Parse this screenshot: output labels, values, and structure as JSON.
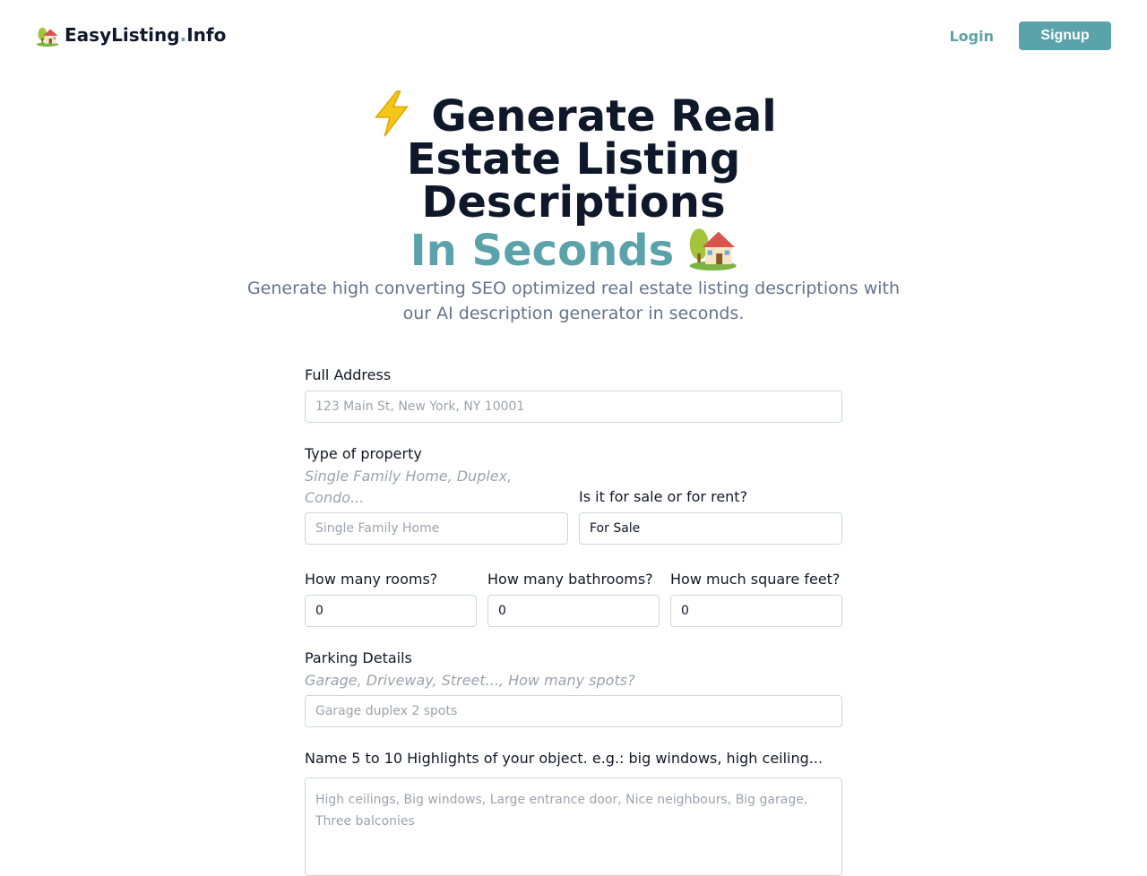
{
  "header": {
    "logo_text_main": "EasyListing",
    "logo_text_dot": ".",
    "logo_text_end": "Info",
    "login_label": "Login",
    "signup_label": "Signup"
  },
  "hero": {
    "title_line1": "Generate Real",
    "title_line2": "Estate Listing",
    "title_line3": "Descriptions",
    "title_accent": "In Seconds",
    "subtitle_line1": "Generate high converting SEO optimized real estate listing descriptions with",
    "subtitle_line2": "our AI description generator in seconds."
  },
  "form": {
    "address": {
      "label": "Full Address",
      "placeholder": "123 Main St, New York, NY 10001"
    },
    "property_type": {
      "label": "Type of property",
      "hint_line1": "Single Family Home, Duplex,",
      "hint_line2": "Condo...",
      "placeholder": "Single Family Home"
    },
    "sale_rent": {
      "label": "Is it for sale or for rent?",
      "value": "For Sale"
    },
    "rooms": {
      "label": "How many rooms?",
      "value": "0"
    },
    "bathrooms": {
      "label": "How many bathrooms?",
      "value": "0"
    },
    "sqft": {
      "label": "How much square feet?",
      "value": "0"
    },
    "parking": {
      "label": "Parking Details",
      "hint": "Garage, Driveway, Street..., How many spots?",
      "placeholder": "Garage duplex 2 spots"
    },
    "highlights": {
      "label": "Name 5 to 10 Highlights of your object. e.g.: big windows, high ceiling...",
      "placeholder_line1": "High ceilings, Big windows, Large entrance door, Nice neighbours, Big garage,",
      "placeholder_line2": "Three balconies"
    }
  },
  "colors": {
    "accent": "#5ba3aa",
    "heading": "#0f172a",
    "muted": "#64748b"
  },
  "icons": {
    "logo": "house-with-garden-icon",
    "bolt": "lightning-bolt-icon",
    "hero_house": "house-with-garden-icon"
  }
}
